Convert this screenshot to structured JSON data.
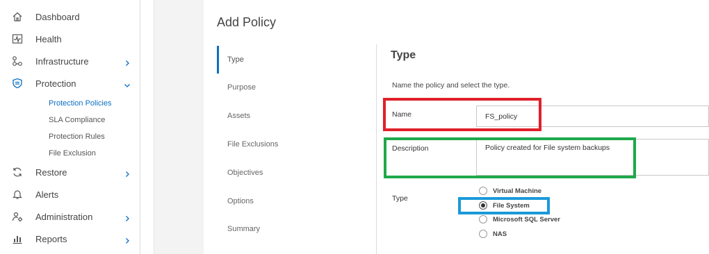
{
  "sidebar": {
    "items": [
      {
        "label": "Dashboard",
        "icon": "home-icon"
      },
      {
        "label": "Health",
        "icon": "health-icon"
      },
      {
        "label": "Infrastructure",
        "icon": "infrastructure-icon",
        "chevron": "right"
      },
      {
        "label": "Protection",
        "icon": "shield-icon",
        "chevron": "down"
      },
      {
        "label": "Restore",
        "icon": "restore-icon",
        "chevron": "right"
      },
      {
        "label": "Alerts",
        "icon": "bell-icon"
      },
      {
        "label": "Administration",
        "icon": "admin-icon",
        "chevron": "right"
      },
      {
        "label": "Reports",
        "icon": "reports-icon",
        "chevron": "right"
      }
    ],
    "protection_subitems": [
      {
        "label": "Protection Policies",
        "active": true
      },
      {
        "label": "SLA Compliance"
      },
      {
        "label": "Protection Rules"
      },
      {
        "label": "File Exclusion"
      }
    ]
  },
  "page": {
    "title": "Add Policy"
  },
  "steps": [
    {
      "label": "Type",
      "active": true
    },
    {
      "label": "Purpose"
    },
    {
      "label": "Assets"
    },
    {
      "label": "File Exclusions"
    },
    {
      "label": "Objectives"
    },
    {
      "label": "Options"
    },
    {
      "label": "Summary"
    }
  ],
  "form": {
    "section_title": "Type",
    "description": "Name the policy and select the type.",
    "name_label": "Name",
    "name_value": "FS_policy",
    "description_label": "Description",
    "description_value": "Policy created for File system backups",
    "type_label": "Type",
    "type_options": [
      {
        "label": "Virtual Machine",
        "checked": false
      },
      {
        "label": "File System",
        "checked": true
      },
      {
        "label": "Microsoft SQL Server",
        "checked": false
      },
      {
        "label": "NAS",
        "checked": false
      }
    ]
  },
  "colors": {
    "accent": "#0b6fc2",
    "highlight_red": "#e0202a",
    "highlight_green": "#1fa84a",
    "highlight_blue": "#1a9ad9"
  }
}
